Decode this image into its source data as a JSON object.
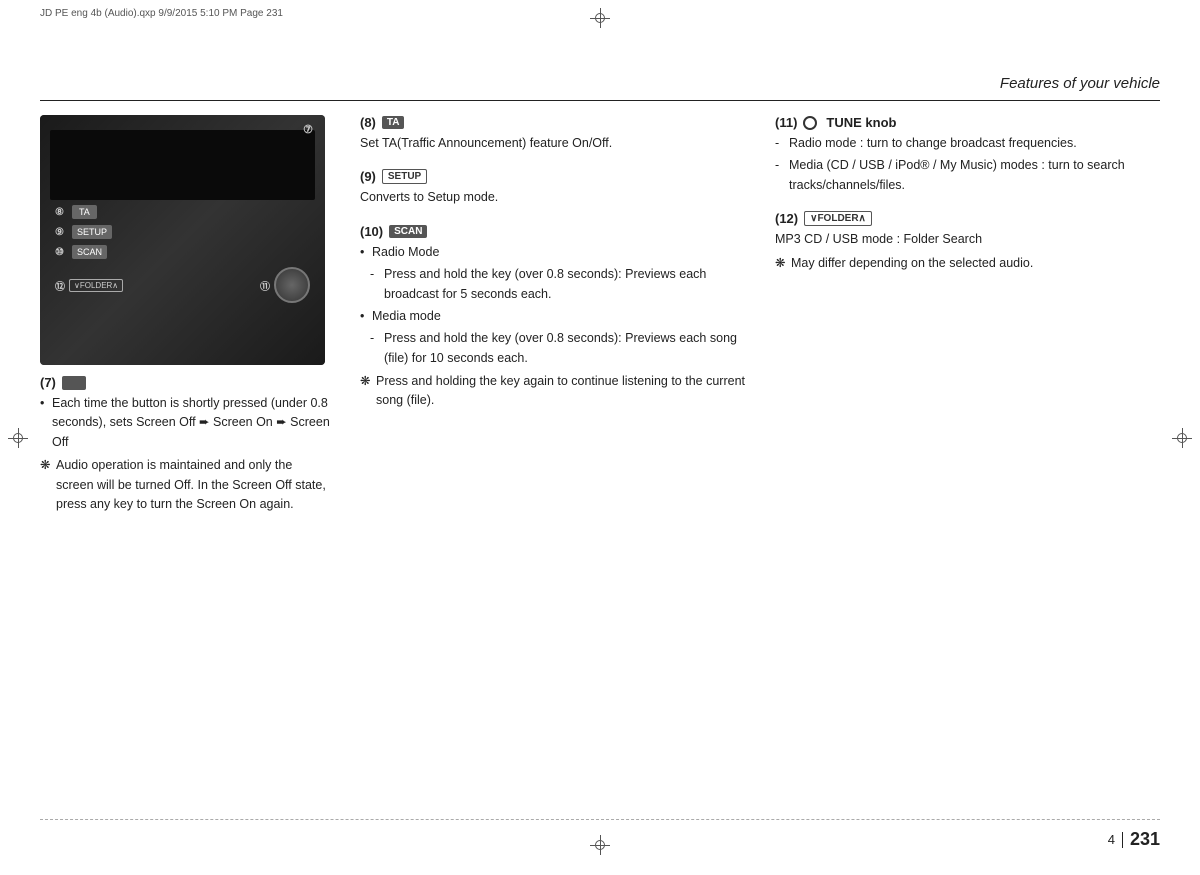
{
  "meta": {
    "print_header": "JD PE eng 4b (Audio).qxp  9/9/2015  5:10 PM  Page 231",
    "page_title": "Features of your vehicle",
    "page_section": "4",
    "page_number": "231"
  },
  "section7": {
    "num": "(7)",
    "bullet1": "Each time the button is shortly pressed (under 0.8 seconds), sets Screen Off",
    "arrow1": "➡",
    "screen_on": "Screen On",
    "arrow2": "➡",
    "screen_off2": "Screen Off",
    "note1_prefix": "❋",
    "note1": "Audio operation is maintained and only the screen will be turned Off. In the Screen Off state, press any key to turn the Screen On again."
  },
  "section8": {
    "num": "(8)",
    "btn_label": "TA",
    "body": "Set TA(Traffic Announcement) feature On/Off."
  },
  "section9": {
    "num": "(9)",
    "btn_label": "SETUP",
    "body": "Converts to Setup mode."
  },
  "section10": {
    "num": "(10)",
    "btn_label": "SCAN",
    "bullet1": "Radio Mode",
    "dash1": "Press and hold the key (over 0.8 seconds): Previews each broadcast for 5 seconds each.",
    "bullet2": "Media mode",
    "dash2": "Press and hold the key (over 0.8 seconds): Previews each song (file) for 10 seconds each.",
    "note1_prefix": "❋",
    "note1": "Press and holding the key again to continue listening to the current song (file)."
  },
  "section11": {
    "num": "(11)",
    "tune_label": "TUNE knob",
    "dash1": "Radio mode : turn to change broadcast frequencies.",
    "dash2": "Media (CD / USB / iPod® / My Music) modes : turn to search tracks/channels/files."
  },
  "section12": {
    "num": "(12)",
    "btn_label": "∨FOLDER∧",
    "body": "MP3 CD / USB mode : Folder Search",
    "note1_prefix": "❋",
    "note1": "May differ depending on the selected audio."
  }
}
